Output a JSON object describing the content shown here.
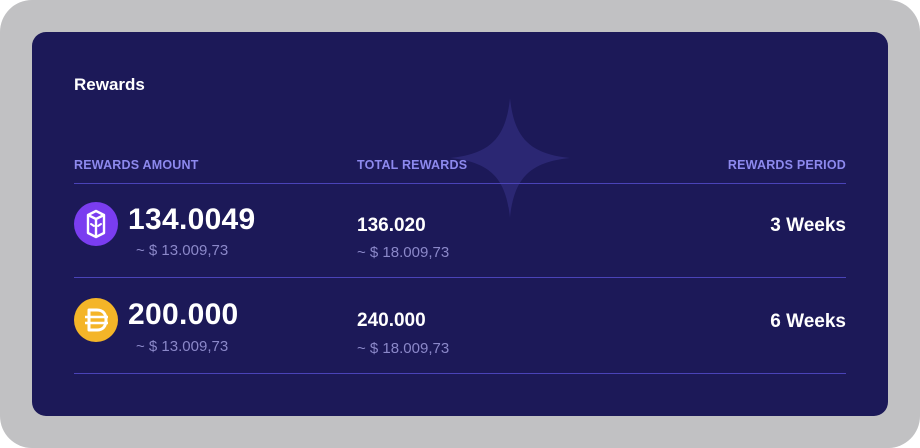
{
  "card": {
    "title": "Rewards"
  },
  "table": {
    "headers": {
      "amount": "REWARDS AMOUNT",
      "total": "TOTAL REWARDS",
      "period": "REWARDS PERIOD"
    },
    "rows": [
      {
        "icon": "purple-cube-token-icon",
        "amount": "134.0049",
        "amount_usd": "~ $ 13.009,73",
        "total": "136.020",
        "total_usd": "~ $ 18.009,73",
        "period": "3 Weeks"
      },
      {
        "icon": "dai-token-icon",
        "amount": "200.000",
        "amount_usd": "~ $ 13.009,73",
        "total": "240.000",
        "total_usd": "~ $ 18.009,73",
        "period": "6 Weeks"
      }
    ]
  },
  "colors": {
    "card_bg": "#1c1958",
    "header_text": "#8d89ee",
    "divider": "#4a43b8",
    "muted_text": "#8b88c9",
    "token1": "#7a3df0",
    "token2": "#f4b528"
  }
}
